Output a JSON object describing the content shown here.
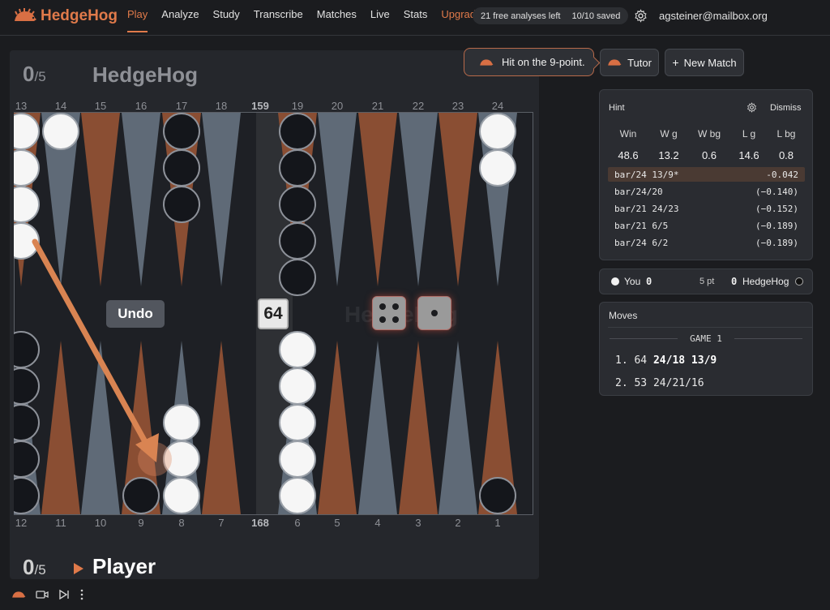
{
  "app": {
    "name": "HedgeHog",
    "brand_color": "#e07a4a"
  },
  "nav": {
    "items": [
      {
        "label": "Play",
        "active": true
      },
      {
        "label": "Analyze"
      },
      {
        "label": "Study"
      },
      {
        "label": "Transcribe"
      },
      {
        "label": "Matches"
      },
      {
        "label": "Live"
      },
      {
        "label": "Stats"
      },
      {
        "label": "Upgrade",
        "highlight": true
      }
    ],
    "usage": {
      "analyses": "21 free analyses left",
      "saved": "10/10 saved"
    },
    "settings_icon": "gear-icon",
    "email": "agsteiner@mailbox.org"
  },
  "board": {
    "top_score": "0",
    "top_score_of": "/5",
    "top_name": "HedgeHog",
    "bottom_score": "0",
    "bottom_score_of": "/5",
    "bottom_name": "Player",
    "top_points": [
      "13",
      "14",
      "15",
      "16",
      "17",
      "18",
      "159",
      "19",
      "20",
      "21",
      "22",
      "23",
      "24"
    ],
    "bottom_points": [
      "12",
      "11",
      "10",
      "9",
      "8",
      "7",
      "168",
      "6",
      "5",
      "4",
      "3",
      "2",
      "1"
    ],
    "undo_label": "Undo",
    "cube": "64",
    "dice": [
      4,
      1
    ],
    "watermark": "HedgeHog",
    "checkers": {
      "white_color": "#f6f6f6",
      "black_color": "#14161b",
      "point_13": {
        "color": "white",
        "count": 4
      },
      "point_14": {
        "color": "white",
        "count": 1
      },
      "point_17": {
        "color": "black",
        "count": 3
      },
      "point_19": {
        "color": "black",
        "count": 5
      },
      "point_24": {
        "color": "white",
        "count": 2
      },
      "point_12": {
        "color": "black",
        "count": 5
      },
      "point_9": {
        "color": "black",
        "count": 1
      },
      "point_8": {
        "color": "white",
        "count": 3
      },
      "point_6": {
        "color": "white",
        "count": 5
      },
      "point_1": {
        "color": "black",
        "count": 1
      }
    },
    "move_arrow": {
      "from": "13",
      "to": "9"
    }
  },
  "hint_bubble": {
    "text": "Hit on the 9-point.",
    "icon": "hedgehog-icon"
  },
  "buttons": {
    "tutor": "Tutor",
    "new_match": "New Match",
    "new_match_icon": "plus-icon"
  },
  "hint_panel": {
    "title": "Hint",
    "dismiss": "Dismiss",
    "headers": [
      "Win",
      "W g",
      "W bg",
      "L g",
      "L bg"
    ],
    "values": [
      "48.6",
      "13.2",
      "0.6",
      "14.6",
      "0.8"
    ],
    "moves": [
      {
        "move": "bar/24 13/9*",
        "equity": "-0.042",
        "selected": true
      },
      {
        "move": "bar/24/20",
        "equity": "(−0.140)"
      },
      {
        "move": "bar/21 24/23",
        "equity": "(−0.152)"
      },
      {
        "move": "bar/21 6/5",
        "equity": "(−0.189)"
      },
      {
        "move": "bar/24 6/2",
        "equity": "(−0.189)"
      }
    ]
  },
  "score_panel": {
    "you_label": "You",
    "you_score": "0",
    "match_length": "5 pt",
    "opp_score": "0",
    "opp_label": "HedgeHog"
  },
  "moves_panel": {
    "title": "Moves",
    "game_label": "GAME 1",
    "lines": [
      {
        "num": "1.",
        "roll": "64",
        "move": "24/18 13/9",
        "bold": true
      },
      {
        "num": "2.",
        "roll": "53",
        "move": "24/21/16",
        "bold": false
      }
    ]
  },
  "toolbar": {
    "icons": [
      "hedgehog-icon",
      "camera-icon",
      "skip-icon",
      "more-icon"
    ]
  }
}
